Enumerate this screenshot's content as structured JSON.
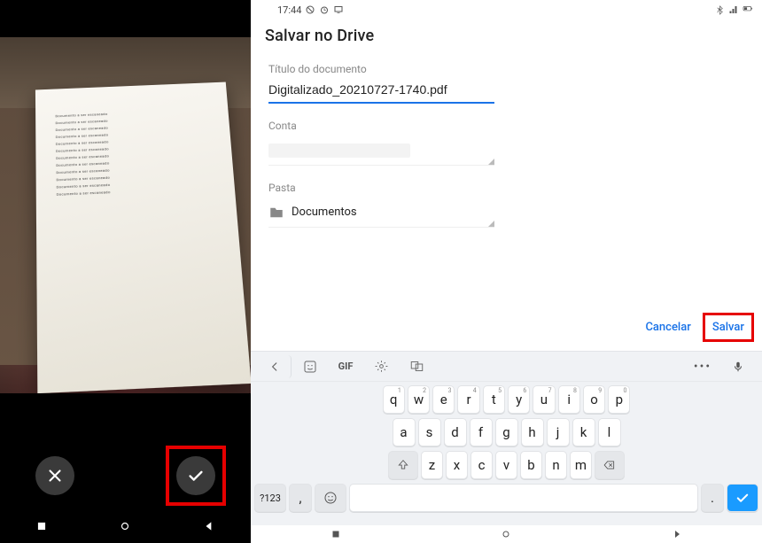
{
  "left": {
    "paper_lines": [
      "Documento a ser escaneado",
      "Documento a ser escaneado",
      "Documento a ser escaneado",
      "Documento a ser escaneado",
      "Documento a ser escaneado",
      "Documento a ser escaneado",
      "Documento a ser escaneado",
      "Documento a ser escaneado",
      "Documento a ser escaneado",
      "Documento a ser escaneado",
      "Documento a ser escaneado",
      "Documento a ser escaneado"
    ]
  },
  "screen": {
    "title": "Salvar no Drive",
    "time": "17:44",
    "status_icons": [
      "dnd-icon",
      "alarm-icon",
      "laptop-icon"
    ],
    "status_right": [
      "bluetooth-icon",
      "signal-icon",
      "battery-icon"
    ]
  },
  "form": {
    "doc_title_label": "Título do documento",
    "doc_title_value": "Digitalizado_20210727-1740.pdf",
    "account_label": "Conta",
    "folder_label": "Pasta",
    "folder_value": "Documentos"
  },
  "actions": {
    "cancel": "Cancelar",
    "save": "Salvar"
  },
  "keyboard": {
    "gif": "GIF",
    "symbols_key": "?123",
    "dots": "•••",
    "row1": [
      {
        "k": "q",
        "s": "1"
      },
      {
        "k": "w",
        "s": "2"
      },
      {
        "k": "e",
        "s": "3"
      },
      {
        "k": "r",
        "s": "4"
      },
      {
        "k": "t",
        "s": "5"
      },
      {
        "k": "y",
        "s": "6"
      },
      {
        "k": "u",
        "s": "7"
      },
      {
        "k": "i",
        "s": "8"
      },
      {
        "k": "o",
        "s": "9"
      },
      {
        "k": "p",
        "s": "0"
      }
    ],
    "row2": [
      {
        "k": "a"
      },
      {
        "k": "s"
      },
      {
        "k": "d"
      },
      {
        "k": "f"
      },
      {
        "k": "g"
      },
      {
        "k": "h"
      },
      {
        "k": "j"
      },
      {
        "k": "k"
      },
      {
        "k": "l"
      }
    ],
    "row3": [
      {
        "k": "z"
      },
      {
        "k": "x"
      },
      {
        "k": "c"
      },
      {
        "k": "v"
      },
      {
        "k": "b"
      },
      {
        "k": "n"
      },
      {
        "k": "m"
      }
    ],
    "comma": ",",
    "dot": "."
  }
}
